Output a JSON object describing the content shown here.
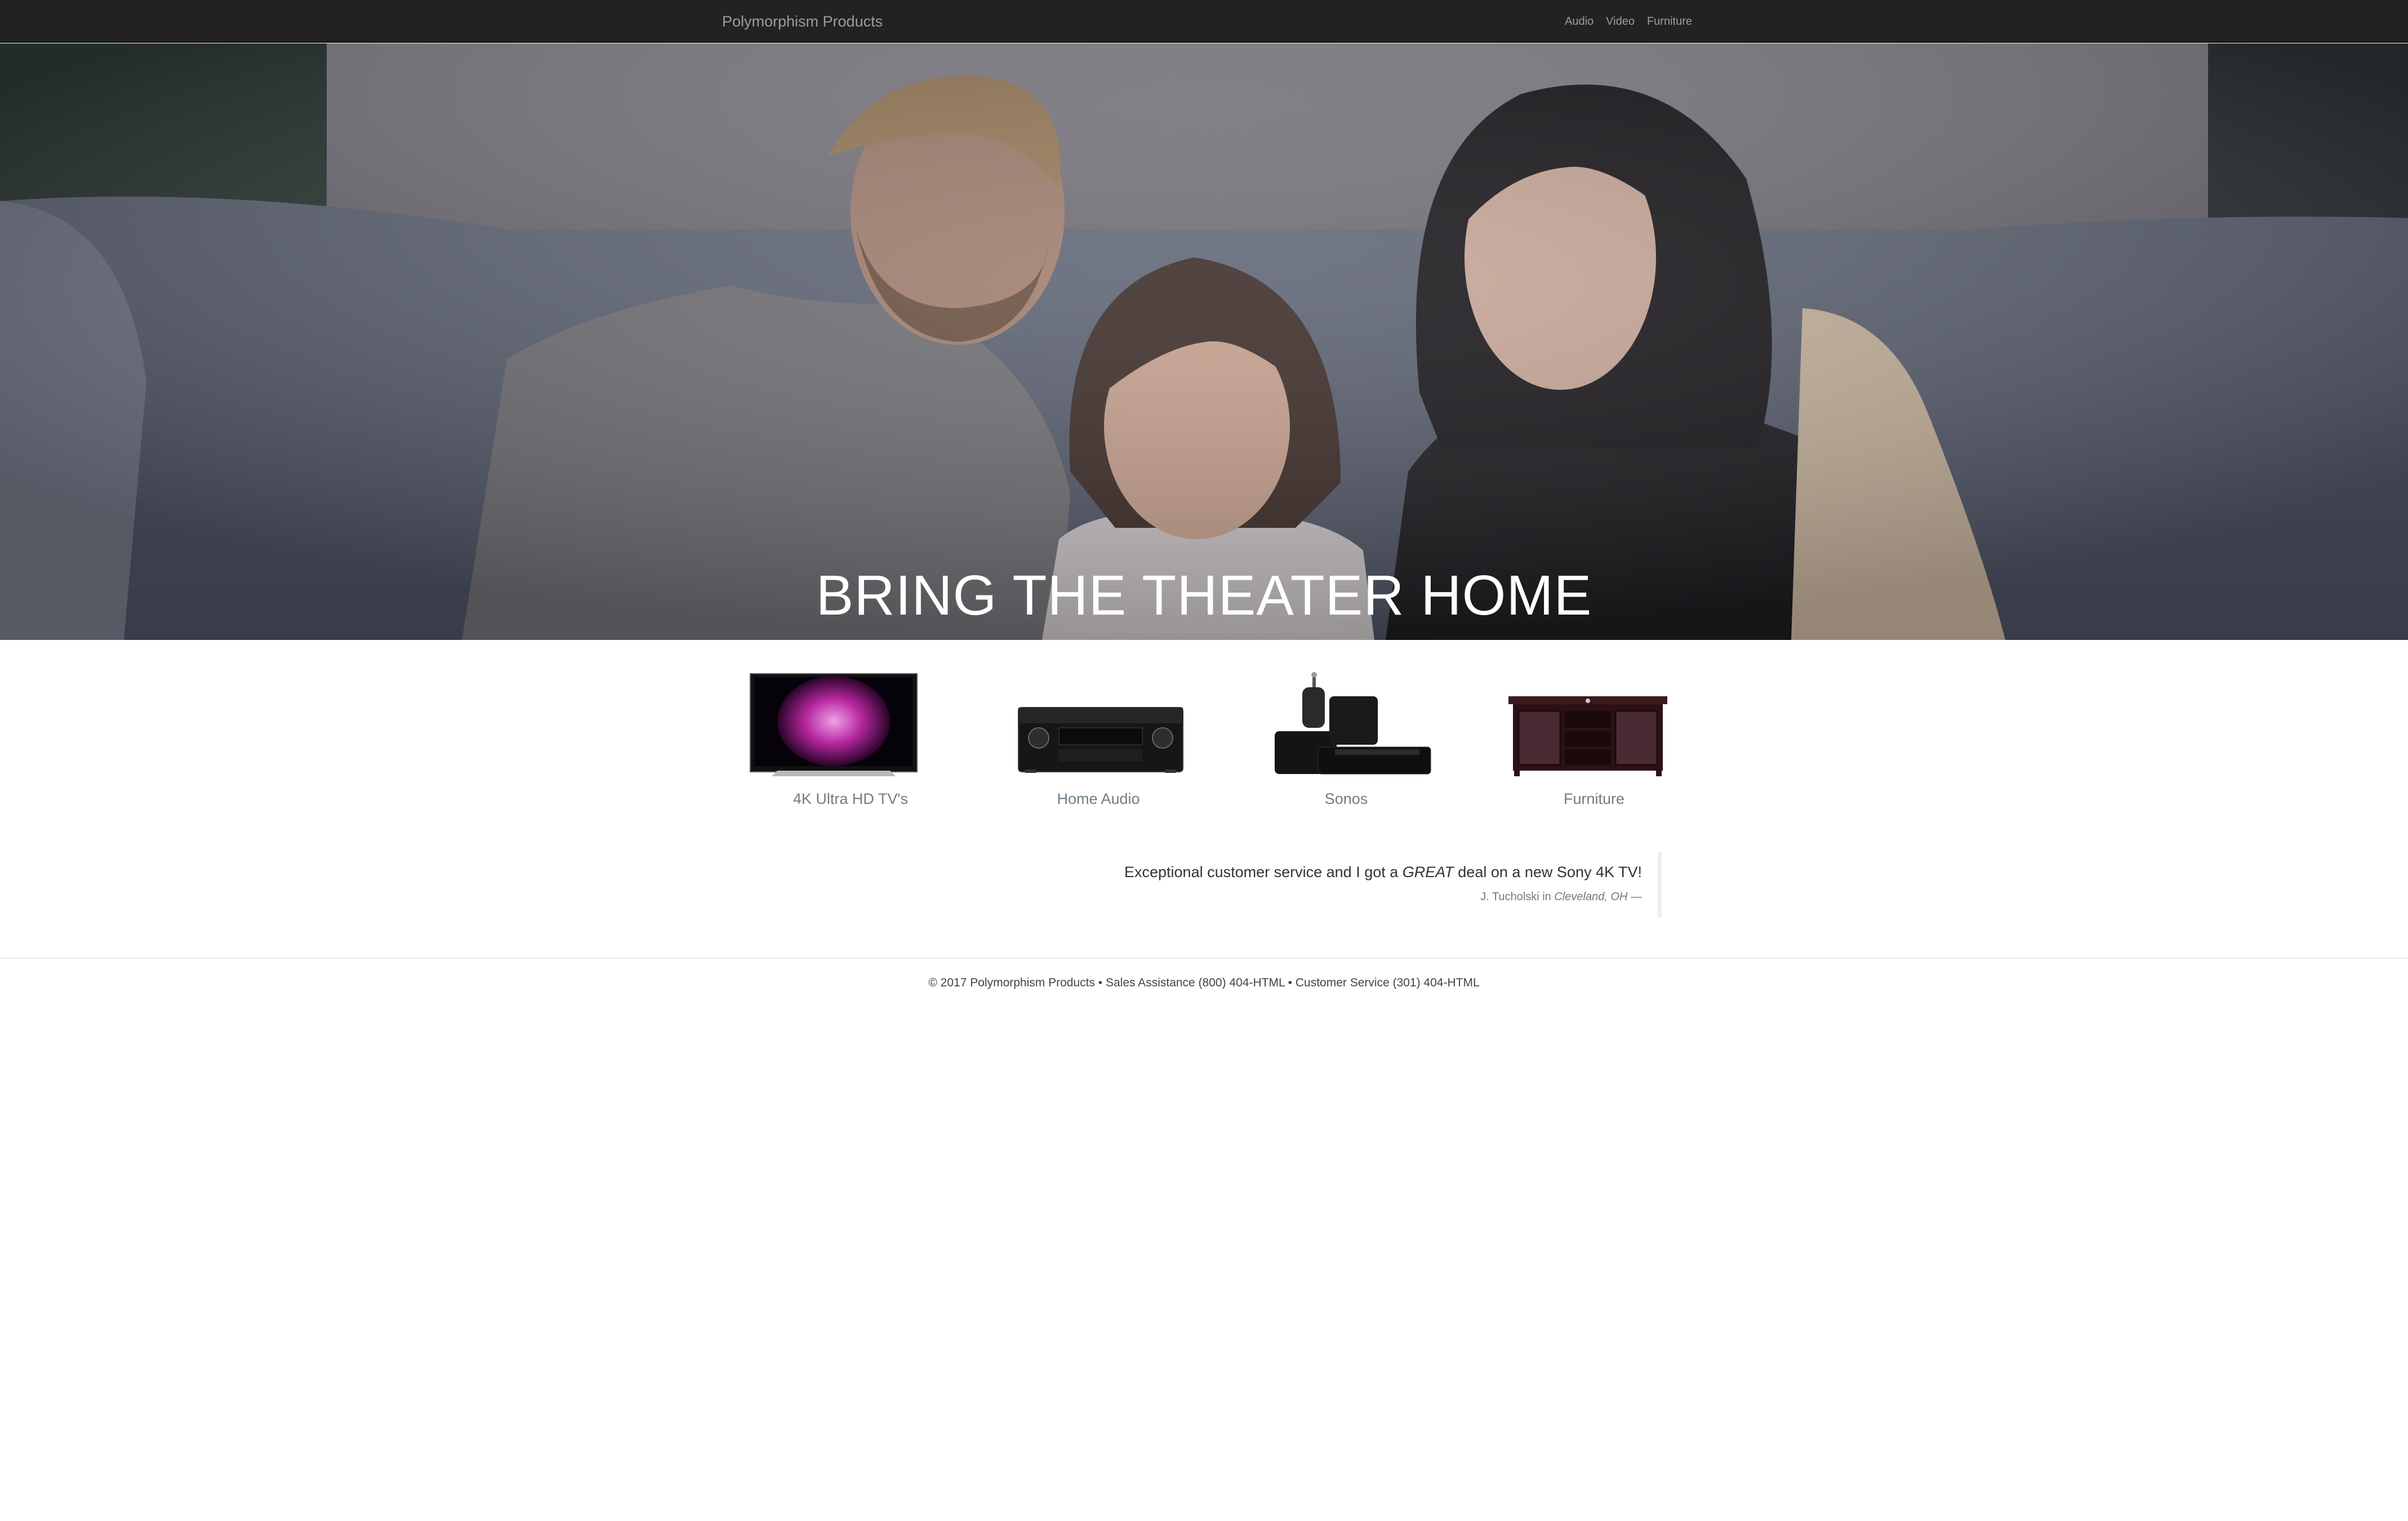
{
  "navbar": {
    "brand": "Polymorphism Products",
    "links": [
      {
        "label": "Audio"
      },
      {
        "label": "Video"
      },
      {
        "label": "Furniture"
      }
    ]
  },
  "hero": {
    "title": "BRING THE THEATER HOME"
  },
  "products": [
    {
      "label": "4K Ultra HD TV's",
      "icon": "tv-icon"
    },
    {
      "label": "Home Audio",
      "icon": "receiver-icon"
    },
    {
      "label": "Sonos",
      "icon": "speaker-icon"
    },
    {
      "label": "Furniture",
      "icon": "tv-stand-icon"
    }
  ],
  "testimonial": {
    "text_before": "Exceptional customer service and I got a ",
    "text_emphasis": "GREAT",
    "text_after": " deal on a new Sony 4K TV!",
    "author": "J. Tucholski in ",
    "location": "Cleveland, OH",
    "dash": " —"
  },
  "footer": {
    "text": "© 2017 Polymorphism Products • Sales Assistance (800) 404-HTML • Customer Service (301) 404-HTML"
  },
  "colors": {
    "navbar_bg": "#222222",
    "navbar_text": "#9d9d9d",
    "product_label": "#6f7d88"
  }
}
